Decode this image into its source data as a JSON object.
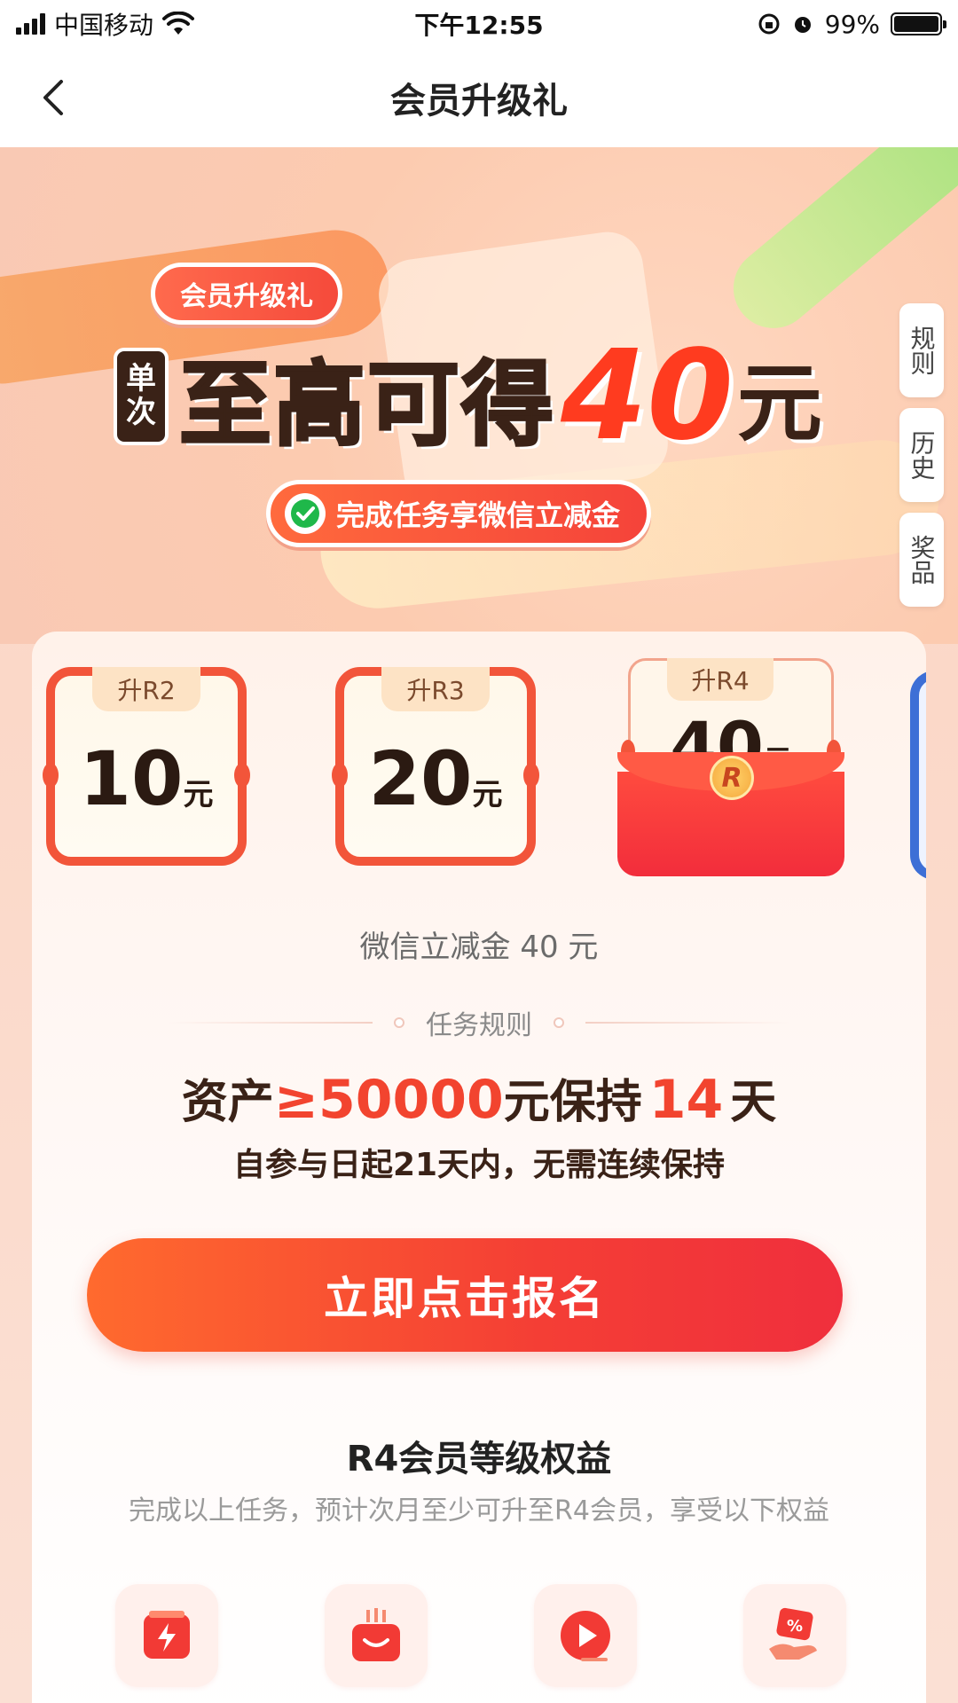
{
  "status_bar": {
    "carrier": "中国移动",
    "time": "下午12:55",
    "battery_percent": "99%",
    "battery_level": 0.99
  },
  "nav": {
    "title": "会员升级礼"
  },
  "hero": {
    "badge": "会员升级礼",
    "single_top": "单",
    "single_bottom": "次",
    "headline": "至高可得",
    "amount": "40",
    "unit": "元",
    "subtitle": "完成任务享微信立减金"
  },
  "side_buttons": {
    "rules": "规则",
    "history": "历史",
    "prizes": "奖品"
  },
  "tiers": [
    {
      "label": "升R2",
      "amount": "10",
      "unit": "元"
    },
    {
      "label": "升R3",
      "amount": "20",
      "unit": "元"
    },
    {
      "label": "升R4",
      "amount": "40",
      "unit": "元",
      "selected": true,
      "coin": "R"
    }
  ],
  "reward_desc": "微信立减金 40 元",
  "task_rules": {
    "divider_title": "任务规则",
    "prefix": "资产",
    "threshold": "≥50000",
    "middle": "元保持",
    "days": "14",
    "suffix": "天",
    "note": "自参与日起21天内，无需连续保持"
  },
  "signup_button": "立即点击报名",
  "benefits": {
    "title": "R4会员等级权益",
    "subtitle": "完成以上任务，预计次月至少可升至R4会员，享受以下权益",
    "icons": [
      "lightning-jar-icon",
      "gift-box-icon",
      "play-video-icon",
      "coupon-hand-icon"
    ]
  },
  "colors": {
    "accent": "#f2442f",
    "brand_red": "#f43e35",
    "dark_text": "#3a2217"
  }
}
